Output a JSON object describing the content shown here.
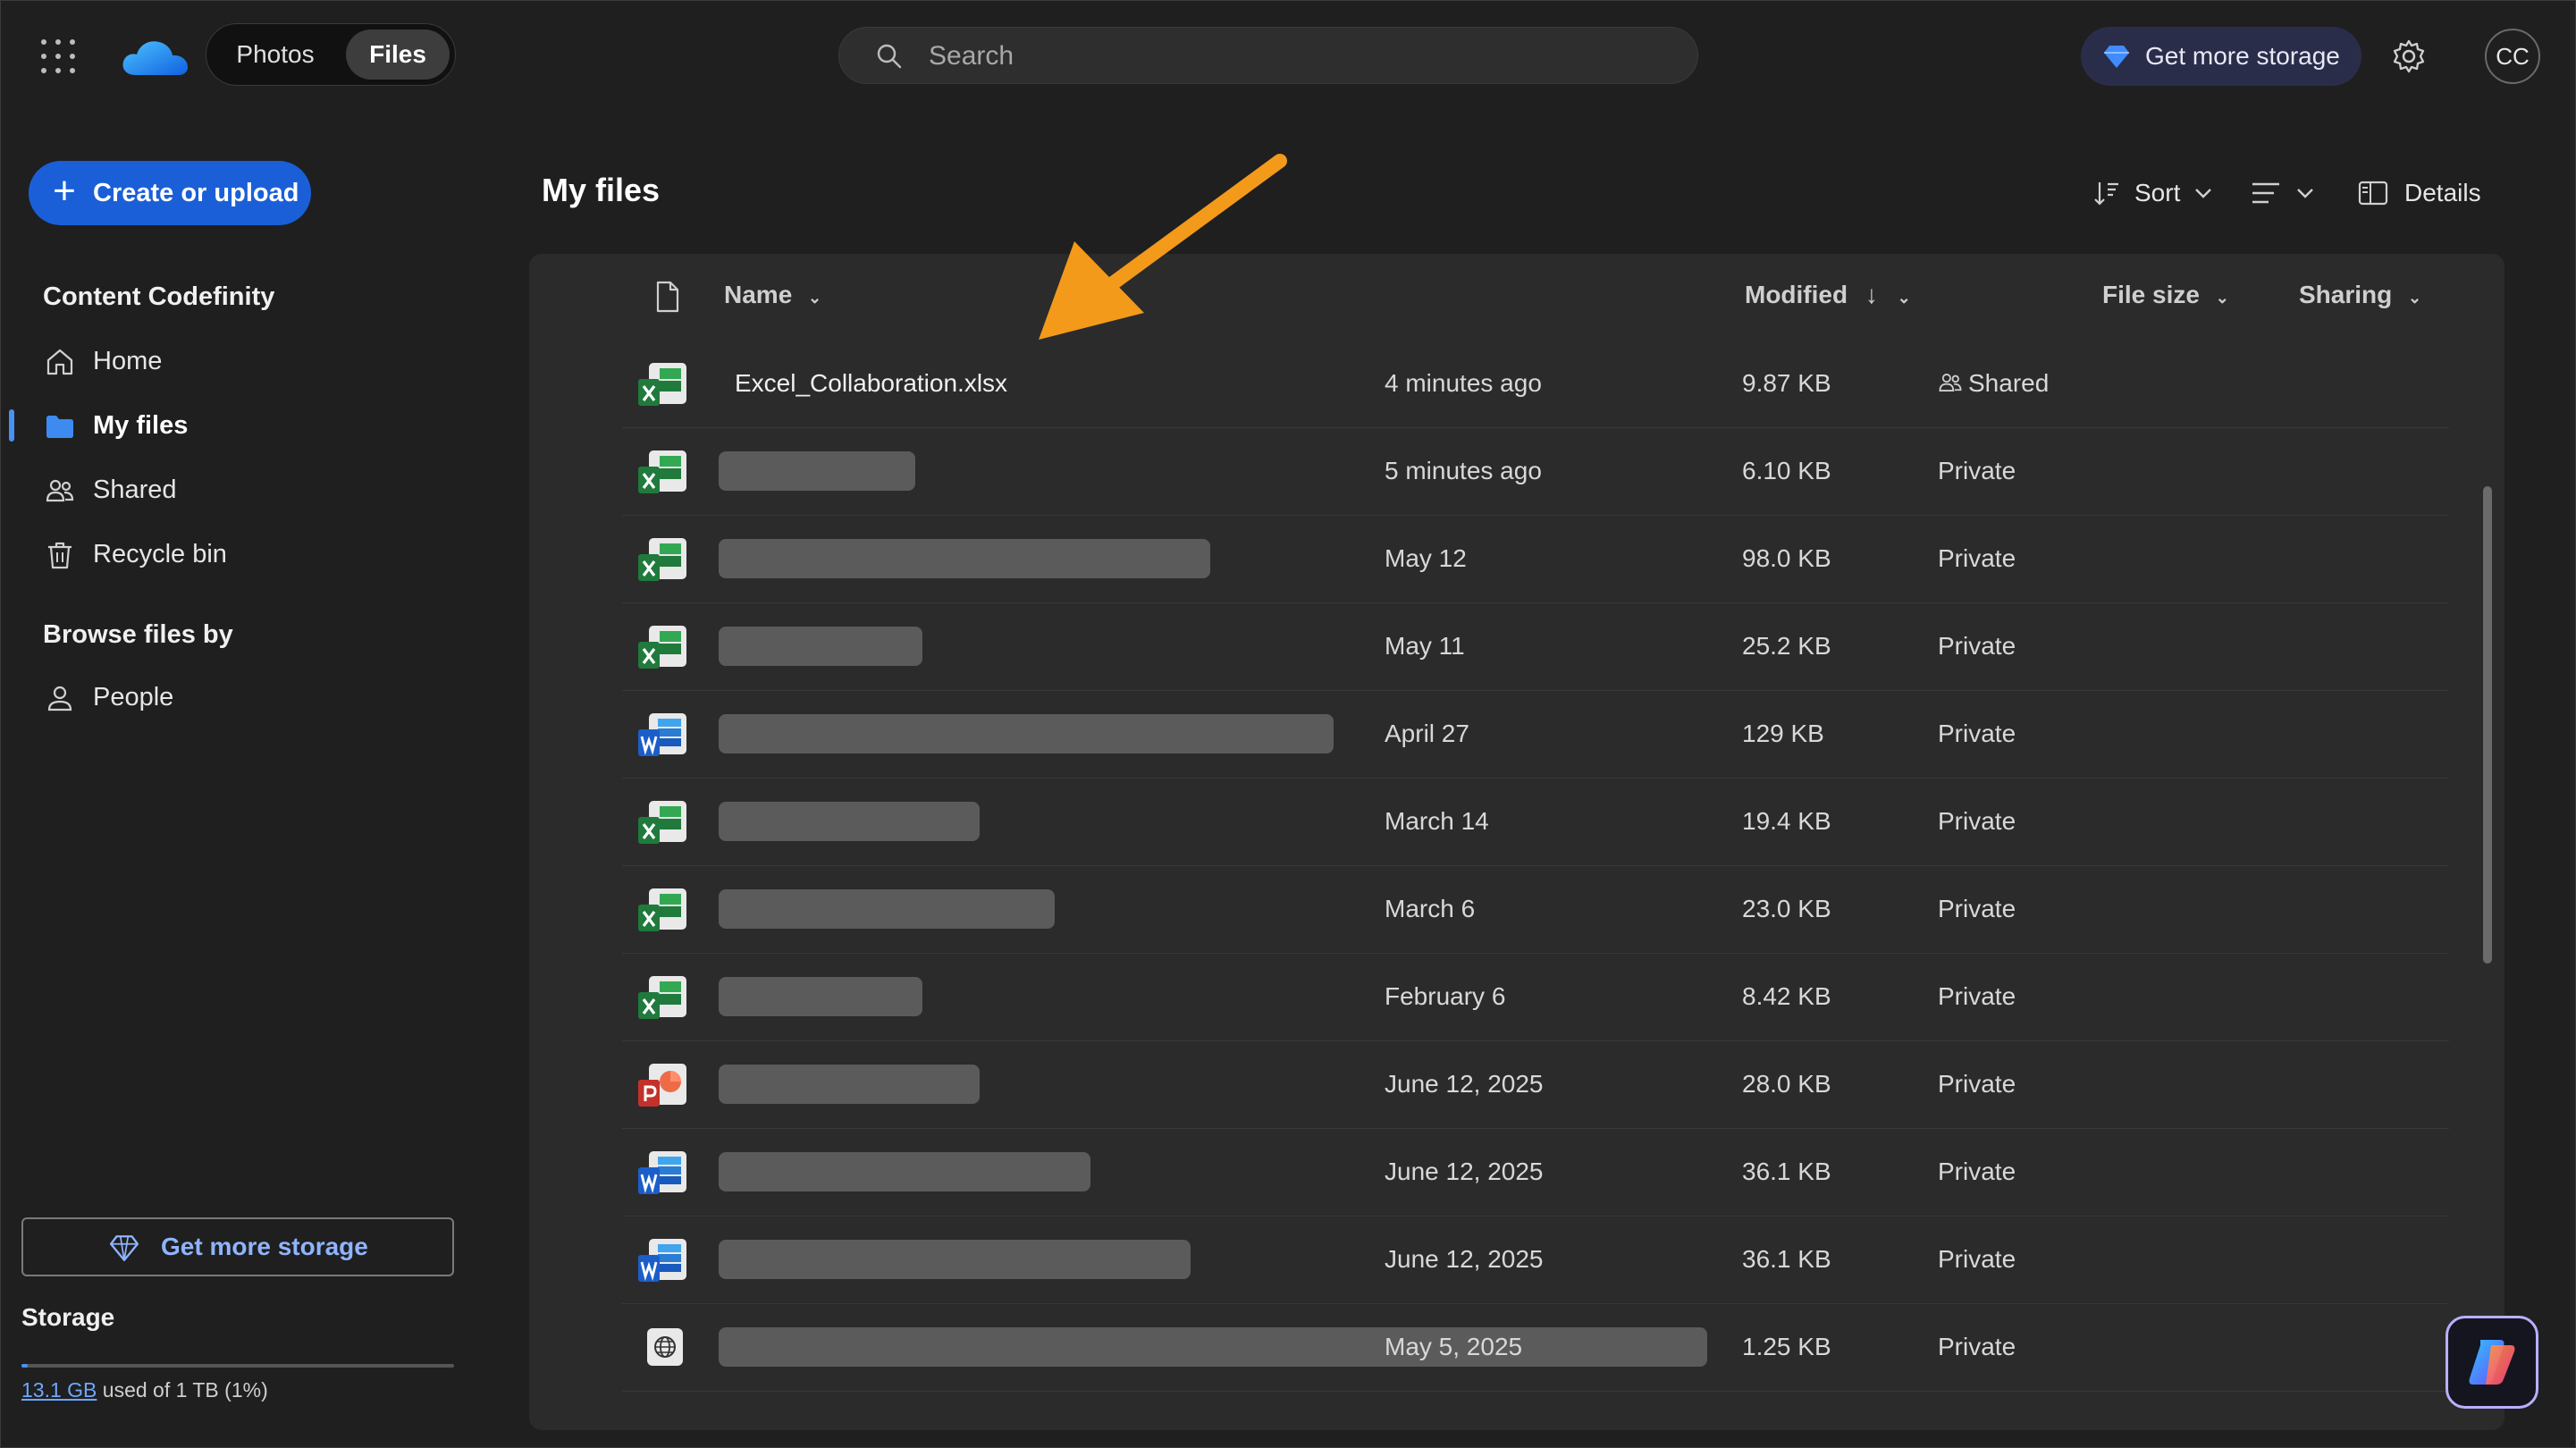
{
  "topbar": {
    "seg_photos": "Photos",
    "seg_files": "Files",
    "search_placeholder": "Search",
    "get_more_storage": "Get more storage",
    "avatar_initials": "CC"
  },
  "sidebar": {
    "create_label": "Create or upload",
    "section_account": "Content Codefinity",
    "items": [
      {
        "label": "Home",
        "icon": "home-icon"
      },
      {
        "label": "My files",
        "icon": "folder-icon"
      },
      {
        "label": "Shared",
        "icon": "people-icon"
      },
      {
        "label": "Recycle bin",
        "icon": "trash-icon"
      }
    ],
    "section_browse": "Browse files by",
    "browse_items": [
      {
        "label": "People",
        "icon": "person-icon"
      }
    ],
    "get_more_storage": "Get more storage",
    "storage_title": "Storage",
    "storage_used": "13.1 GB",
    "storage_rest": " used of 1 TB (1%)",
    "storage_fraction": 0.01
  },
  "main": {
    "title": "My files",
    "sort_label": "Sort",
    "details_label": "Details",
    "columns": {
      "name": "Name",
      "modified": "Modified",
      "size": "File size",
      "sharing": "Sharing"
    },
    "rows": [
      {
        "type": "excel",
        "name": "Excel_Collaboration.xlsx",
        "modified": "4 minutes ago",
        "size": "9.87 KB",
        "sharing": "Shared"
      },
      {
        "type": "excel",
        "name": "",
        "modified": "5 minutes ago",
        "size": "6.10 KB",
        "sharing": "Private"
      },
      {
        "type": "excel",
        "name": "",
        "modified": "May 12",
        "size": "98.0 KB",
        "sharing": "Private"
      },
      {
        "type": "excel",
        "name": "",
        "modified": "May 11",
        "size": "25.2 KB",
        "sharing": "Private"
      },
      {
        "type": "word",
        "name": "",
        "modified": "April 27",
        "size": "129 KB",
        "sharing": "Private"
      },
      {
        "type": "excel",
        "name": "",
        "modified": "March 14",
        "size": "19.4 KB",
        "sharing": "Private"
      },
      {
        "type": "excel",
        "name": "",
        "modified": "March 6",
        "size": "23.0 KB",
        "sharing": "Private"
      },
      {
        "type": "excel",
        "name": "",
        "modified": "February 6",
        "size": "8.42 KB",
        "sharing": "Private"
      },
      {
        "type": "powerpoint",
        "name": "",
        "modified": "June 12, 2025",
        "size": "28.0 KB",
        "sharing": "Private"
      },
      {
        "type": "word",
        "name": "",
        "modified": "June 12, 2025",
        "size": "36.1 KB",
        "sharing": "Private"
      },
      {
        "type": "word",
        "name": "",
        "modified": "June 12, 2025",
        "size": "36.1 KB",
        "sharing": "Private"
      },
      {
        "type": "web",
        "name": "",
        "modified": "May 5, 2025",
        "size": "1.25 KB",
        "sharing": "Private"
      }
    ]
  },
  "colors": {
    "accent": "#1a5fd8",
    "excel": "#1f7a3c",
    "word": "#1b5ec9",
    "powerpoint": "#c4312b",
    "arrow": "#f39a1a"
  }
}
